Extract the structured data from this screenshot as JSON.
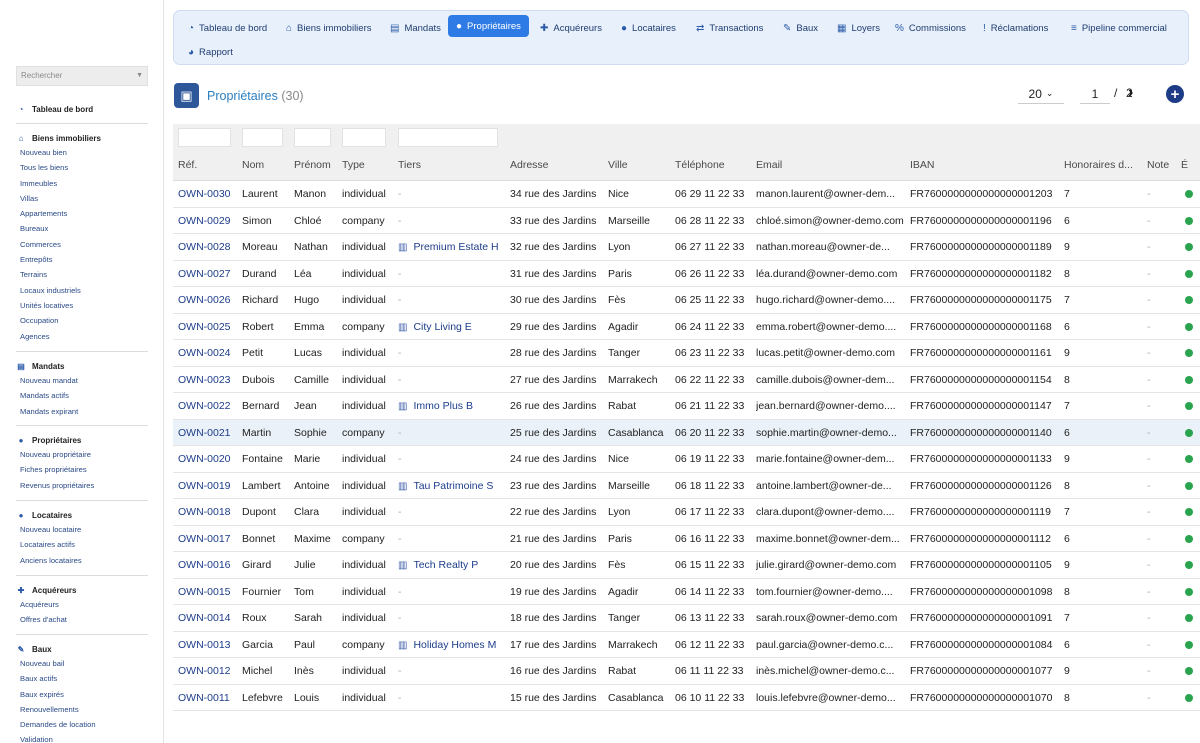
{
  "sidebar": {
    "search_placeholder": "Rechercher",
    "sections": [
      {
        "title": "Tableau de bord",
        "icon": "gauge-icon",
        "items": []
      },
      {
        "title": "Biens immobiliers",
        "icon": "home-icon",
        "items": [
          "Nouveau bien",
          "Tous les biens",
          "Immeubles",
          "Villas",
          "Appartements",
          "Bureaux",
          "Commerces",
          "Entrepôts",
          "Terrains",
          "Locaux industriels",
          "Unités locatives",
          "Occupation",
          "Agences"
        ]
      },
      {
        "title": "Mandats",
        "icon": "document-icon",
        "items": [
          "Nouveau mandat",
          "Mandats actifs",
          "Mandats expirant"
        ]
      },
      {
        "title": "Propriétaires",
        "icon": "user-icon",
        "items": [
          "Nouveau propriétaire",
          "Fiches propriétaires",
          "Revenus propriétaires"
        ]
      },
      {
        "title": "Locataires",
        "icon": "user-icon",
        "items": [
          "Nouveau locataire",
          "Locataires actifs",
          "Anciens locataires"
        ]
      },
      {
        "title": "Acquéreurs",
        "icon": "user-plus-icon",
        "items": [
          "Acquéreurs",
          "Offres d'achat"
        ]
      },
      {
        "title": "Baux",
        "icon": "signature-icon",
        "items": [
          "Nouveau bail",
          "Baux actifs",
          "Baux expirés",
          "Renouvellements",
          "Demandes de location",
          "Validation"
        ]
      }
    ]
  },
  "nav": {
    "tabs": [
      {
        "label": "Tableau de bord",
        "icon": "gauge-icon",
        "glyph": "◔"
      },
      {
        "label": "Biens immobiliers",
        "icon": "home-icon",
        "glyph": "⌂"
      },
      {
        "label": "Mandats",
        "icon": "document-icon",
        "glyph": "▤"
      },
      {
        "label": "Propriétaires",
        "icon": "user-icon",
        "glyph": "●",
        "active": true
      },
      {
        "label": "Acquéreurs",
        "icon": "user-plus-icon",
        "glyph": "✚"
      },
      {
        "label": "Locataires",
        "icon": "user-icon",
        "glyph": "●"
      },
      {
        "label": "Transactions",
        "icon": "handshake-icon",
        "glyph": "⇄"
      },
      {
        "label": "Baux",
        "icon": "signature-icon",
        "glyph": "✎"
      },
      {
        "label": "Loyers",
        "icon": "receipt-icon",
        "glyph": "▦"
      },
      {
        "label": "Commissions",
        "icon": "percent-icon",
        "glyph": "%"
      },
      {
        "label": "Réclamations",
        "icon": "alert-icon",
        "glyph": "!"
      },
      {
        "label": "Pipeline commercial",
        "icon": "bars-icon",
        "glyph": "≡"
      },
      {
        "label": "Rapport",
        "icon": "pie-chart-icon",
        "glyph": "◕"
      }
    ]
  },
  "header": {
    "title": "Propriétaires",
    "count": "(30)",
    "per_page": "20",
    "current_page": "1",
    "separator": "/",
    "total_pages": "2"
  },
  "table": {
    "columns": [
      "Réf.",
      "Nom",
      "Prénom",
      "Type",
      "Tiers",
      "Adresse",
      "Ville",
      "Téléphone",
      "Email",
      "IBAN",
      "Honoraires d...",
      "Note",
      "É"
    ],
    "rows": [
      {
        "ref": "OWN-0030",
        "nom": "Laurent",
        "prenom": "Manon",
        "type": "individual",
        "tiers": "-",
        "adresse": "34 rue des Jardins",
        "ville": "Nice",
        "tel": "06 29 11 22 33",
        "email": "manon.laurent@owner-dem...",
        "iban": "FR7600000000000000001203",
        "hon": "7",
        "note": "-"
      },
      {
        "ref": "OWN-0029",
        "nom": "Simon",
        "prenom": "Chloé",
        "type": "company",
        "tiers": "-",
        "adresse": "33 rue des Jardins",
        "ville": "Marseille",
        "tel": "06 28 11 22 33",
        "email": "chloé.simon@owner-demo.com",
        "iban": "FR7600000000000000001196",
        "hon": "6",
        "note": "-"
      },
      {
        "ref": "OWN-0028",
        "nom": "Moreau",
        "prenom": "Nathan",
        "type": "individual",
        "tiers": "Premium Estate H",
        "adresse": "32 rue des Jardins",
        "ville": "Lyon",
        "tel": "06 27 11 22 33",
        "email": "nathan.moreau@owner-de...",
        "iban": "FR7600000000000000001189",
        "hon": "9",
        "note": "-"
      },
      {
        "ref": "OWN-0027",
        "nom": "Durand",
        "prenom": "Léa",
        "type": "individual",
        "tiers": "-",
        "adresse": "31 rue des Jardins",
        "ville": "Paris",
        "tel": "06 26 11 22 33",
        "email": "léa.durand@owner-demo.com",
        "iban": "FR7600000000000000001182",
        "hon": "8",
        "note": "-"
      },
      {
        "ref": "OWN-0026",
        "nom": "Richard",
        "prenom": "Hugo",
        "type": "individual",
        "tiers": "-",
        "adresse": "30 rue des Jardins",
        "ville": "Fès",
        "tel": "06 25 11 22 33",
        "email": "hugo.richard@owner-demo....",
        "iban": "FR7600000000000000001175",
        "hon": "7",
        "note": "-"
      },
      {
        "ref": "OWN-0025",
        "nom": "Robert",
        "prenom": "Emma",
        "type": "company",
        "tiers": "City Living E",
        "adresse": "29 rue des Jardins",
        "ville": "Agadir",
        "tel": "06 24 11 22 33",
        "email": "emma.robert@owner-demo....",
        "iban": "FR7600000000000000001168",
        "hon": "6",
        "note": "-"
      },
      {
        "ref": "OWN-0024",
        "nom": "Petit",
        "prenom": "Lucas",
        "type": "individual",
        "tiers": "-",
        "adresse": "28 rue des Jardins",
        "ville": "Tanger",
        "tel": "06 23 11 22 33",
        "email": "lucas.petit@owner-demo.com",
        "iban": "FR7600000000000000001161",
        "hon": "9",
        "note": "-"
      },
      {
        "ref": "OWN-0023",
        "nom": "Dubois",
        "prenom": "Camille",
        "type": "individual",
        "tiers": "-",
        "adresse": "27 rue des Jardins",
        "ville": "Marrakech",
        "tel": "06 22 11 22 33",
        "email": "camille.dubois@owner-dem...",
        "iban": "FR7600000000000000001154",
        "hon": "8",
        "note": "-"
      },
      {
        "ref": "OWN-0022",
        "nom": "Bernard",
        "prenom": "Jean",
        "type": "individual",
        "tiers": "Immo Plus B",
        "adresse": "26 rue des Jardins",
        "ville": "Rabat",
        "tel": "06 21 11 22 33",
        "email": "jean.bernard@owner-demo....",
        "iban": "FR7600000000000000001147",
        "hon": "7",
        "note": "-"
      },
      {
        "ref": "OWN-0021",
        "nom": "Martin",
        "prenom": "Sophie",
        "type": "company",
        "tiers": "-",
        "adresse": "25 rue des Jardins",
        "ville": "Casablanca",
        "tel": "06 20 11 22 33",
        "email": "sophie.martin@owner-demo...",
        "iban": "FR7600000000000000001140",
        "hon": "6",
        "note": "-",
        "hl": true
      },
      {
        "ref": "OWN-0020",
        "nom": "Fontaine",
        "prenom": "Marie",
        "type": "individual",
        "tiers": "-",
        "adresse": "24 rue des Jardins",
        "ville": "Nice",
        "tel": "06 19 11 22 33",
        "email": "marie.fontaine@owner-dem...",
        "iban": "FR7600000000000000001133",
        "hon": "9",
        "note": "-"
      },
      {
        "ref": "OWN-0019",
        "nom": "Lambert",
        "prenom": "Antoine",
        "type": "individual",
        "tiers": "Tau Patrimoine S",
        "adresse": "23 rue des Jardins",
        "ville": "Marseille",
        "tel": "06 18 11 22 33",
        "email": "antoine.lambert@owner-de...",
        "iban": "FR7600000000000000001126",
        "hon": "8",
        "note": "-"
      },
      {
        "ref": "OWN-0018",
        "nom": "Dupont",
        "prenom": "Clara",
        "type": "individual",
        "tiers": "-",
        "adresse": "22 rue des Jardins",
        "ville": "Lyon",
        "tel": "06 17 11 22 33",
        "email": "clara.dupont@owner-demo....",
        "iban": "FR7600000000000000001119",
        "hon": "7",
        "note": "-"
      },
      {
        "ref": "OWN-0017",
        "nom": "Bonnet",
        "prenom": "Maxime",
        "type": "company",
        "tiers": "-",
        "adresse": "21 rue des Jardins",
        "ville": "Paris",
        "tel": "06 16 11 22 33",
        "email": "maxime.bonnet@owner-dem...",
        "iban": "FR7600000000000000001112",
        "hon": "6",
        "note": "-"
      },
      {
        "ref": "OWN-0016",
        "nom": "Girard",
        "prenom": "Julie",
        "type": "individual",
        "tiers": "Tech Realty P",
        "adresse": "20 rue des Jardins",
        "ville": "Fès",
        "tel": "06 15 11 22 33",
        "email": "julie.girard@owner-demo.com",
        "iban": "FR7600000000000000001105",
        "hon": "9",
        "note": "-"
      },
      {
        "ref": "OWN-0015",
        "nom": "Fournier",
        "prenom": "Tom",
        "type": "individual",
        "tiers": "-",
        "adresse": "19 rue des Jardins",
        "ville": "Agadir",
        "tel": "06 14 11 22 33",
        "email": "tom.fournier@owner-demo....",
        "iban": "FR7600000000000000001098",
        "hon": "8",
        "note": "-"
      },
      {
        "ref": "OWN-0014",
        "nom": "Roux",
        "prenom": "Sarah",
        "type": "individual",
        "tiers": "-",
        "adresse": "18 rue des Jardins",
        "ville": "Tanger",
        "tel": "06 13 11 22 33",
        "email": "sarah.roux@owner-demo.com",
        "iban": "FR7600000000000000001091",
        "hon": "7",
        "note": "-"
      },
      {
        "ref": "OWN-0013",
        "nom": "Garcia",
        "prenom": "Paul",
        "type": "company",
        "tiers": "Holiday Homes M",
        "adresse": "17 rue des Jardins",
        "ville": "Marrakech",
        "tel": "06 12 11 22 33",
        "email": "paul.garcia@owner-demo.c...",
        "iban": "FR7600000000000000001084",
        "hon": "6",
        "note": "-"
      },
      {
        "ref": "OWN-0012",
        "nom": "Michel",
        "prenom": "Inès",
        "type": "individual",
        "tiers": "-",
        "adresse": "16 rue des Jardins",
        "ville": "Rabat",
        "tel": "06 11 11 22 33",
        "email": "inès.michel@owner-demo.c...",
        "iban": "FR7600000000000000001077",
        "hon": "9",
        "note": "-"
      },
      {
        "ref": "OWN-0011",
        "nom": "Lefebvre",
        "prenom": "Louis",
        "type": "individual",
        "tiers": "-",
        "adresse": "15 rue des Jardins",
        "ville": "Casablanca",
        "tel": "06 10 11 22 33",
        "email": "louis.lefebvre@owner-demo...",
        "iban": "FR7600000000000000001070",
        "hon": "8",
        "note": "-"
      }
    ]
  },
  "colors": {
    "accent": "#2f7be6",
    "link": "#1d3d8a",
    "status_active": "#2aa44f",
    "header_icon_bg": "#2e5799"
  }
}
